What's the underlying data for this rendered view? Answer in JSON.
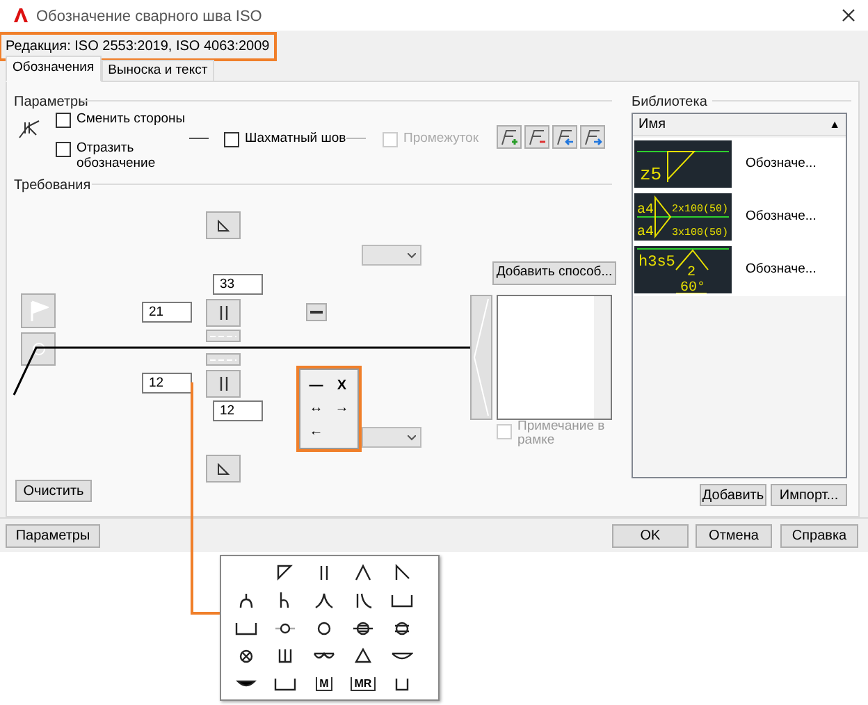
{
  "window": {
    "title": "Обозначение сварного шва ISO"
  },
  "edition": {
    "label": "Редакция: ISO 2553:2019, ISO 4063:2009",
    "highlighted": true
  },
  "tabs": [
    {
      "label": "Обозначения",
      "selected": true
    },
    {
      "label": "Выноска и текст",
      "selected": false
    }
  ],
  "parameters": {
    "title": "Параметры",
    "options": [
      {
        "label": "Сменить стороны",
        "checked": false,
        "disabled": false
      },
      {
        "label": "Отразить обозначение",
        "checked": false,
        "disabled": false
      },
      {
        "label": "Шахматный шов",
        "checked": false,
        "disabled": false
      },
      {
        "label": "Промежуток",
        "checked": false,
        "disabled": true
      }
    ]
  },
  "requirements": {
    "title": "Требования",
    "fields": [
      {
        "value": "33"
      },
      {
        "value": "21"
      },
      {
        "value": "12"
      },
      {
        "value": "12"
      }
    ],
    "add_method_button": "Добавить способ...",
    "note_in_frame": {
      "label": "Примечание в рамке",
      "checked": false,
      "disabled": true
    },
    "clear_button": "Очистить"
  },
  "direction_popup": {
    "highlighted": true,
    "items": [
      "—",
      "X",
      "↔",
      "→",
      "←"
    ]
  },
  "library": {
    "title": "Библиотека",
    "column": "Имя",
    "sort": "▲",
    "items": [
      {
        "name": "Обозначе...",
        "preview": {
          "kind": "fillet",
          "texts": [
            "z5"
          ]
        }
      },
      {
        "name": "Обозначе...",
        "preview": {
          "kind": "intermittent",
          "texts": [
            "a4",
            "2x100(50)",
            "a4",
            "3x100(50)"
          ]
        }
      },
      {
        "name": "Обозначе...",
        "preview": {
          "kind": "groove",
          "texts": [
            "h3s5",
            "2",
            "60°"
          ]
        }
      }
    ]
  },
  "buttons": {
    "add": "Добавить",
    "import": "Импорт...",
    "settings": "Параметры",
    "ok": "OK",
    "cancel": "Отмена",
    "help": "Справка"
  },
  "symbol_palette": {
    "highlighted": true,
    "items": [
      {
        "kind": "empty"
      },
      {
        "kind": "symbol"
      },
      {
        "kind": "symbol"
      },
      {
        "kind": "symbol"
      },
      {
        "kind": "symbol"
      },
      {
        "kind": "symbol"
      },
      {
        "kind": "symbol"
      },
      {
        "kind": "symbol"
      },
      {
        "kind": "symbol"
      },
      {
        "kind": "symbol"
      },
      {
        "kind": "symbol"
      },
      {
        "kind": "symbol"
      },
      {
        "kind": "symbol"
      },
      {
        "kind": "symbol"
      },
      {
        "kind": "symbol"
      },
      {
        "kind": "symbol"
      },
      {
        "kind": "symbol"
      },
      {
        "kind": "symbol"
      },
      {
        "kind": "symbol"
      },
      {
        "kind": "symbol"
      },
      {
        "kind": "symbol"
      },
      {
        "kind": "symbol"
      },
      {
        "kind": "labeled",
        "label": "M"
      },
      {
        "kind": "labeled",
        "label": "MR"
      },
      {
        "kind": "symbol"
      }
    ]
  }
}
